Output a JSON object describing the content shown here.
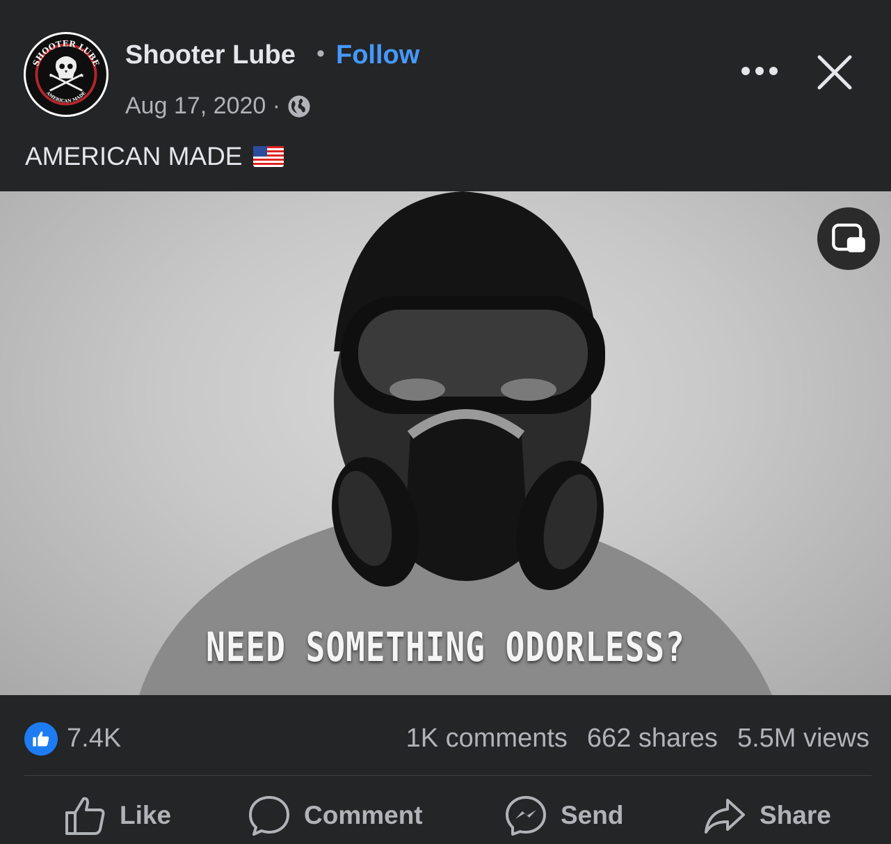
{
  "post": {
    "page_name": "Shooter Lube",
    "separator": "•",
    "follow_label": "Follow",
    "date": "Aug 17, 2020 ·",
    "caption": "AMERICAN MADE",
    "avatar_text": {
      "top": "SHOOTER LUBE",
      "bottom": "AMERICAN MADE"
    }
  },
  "video": {
    "subtitle": "NEED SOMETHING ODORLESS?"
  },
  "stats": {
    "likes": "7.4K",
    "comments": "1K comments",
    "shares": "662 shares",
    "views": "5.5M views"
  },
  "actions": {
    "like": "Like",
    "comment": "Comment",
    "send": "Send",
    "share": "Share"
  },
  "colors": {
    "background": "#242526",
    "accent": "#4599ff",
    "like_badge": "#1d7cf2",
    "muted_text": "#b0b3b8"
  },
  "icons": [
    "globe-icon",
    "flag-icon",
    "more-icon",
    "close-icon",
    "pip-icon",
    "thumbs-up-icon",
    "comment-icon",
    "messenger-icon",
    "share-icon"
  ]
}
